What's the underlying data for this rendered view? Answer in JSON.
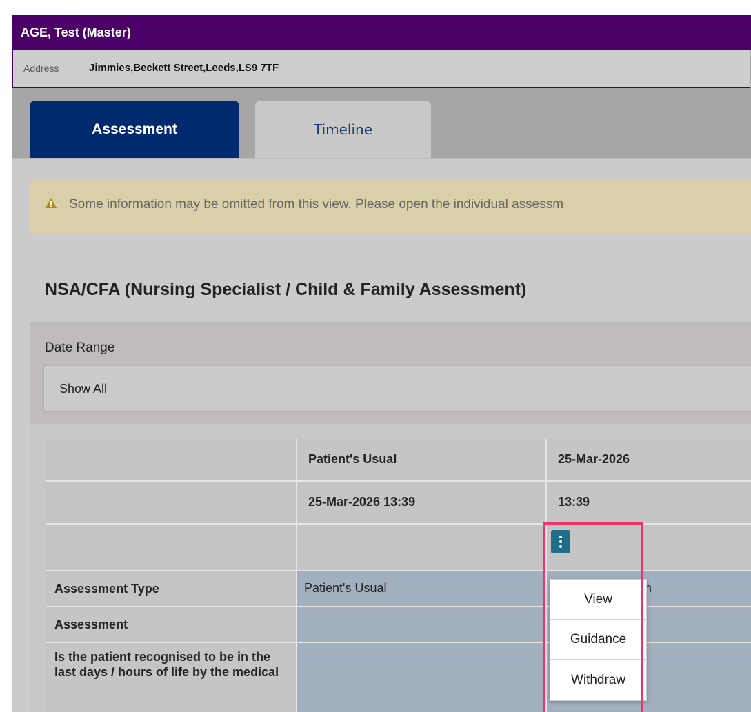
{
  "patient": {
    "name": "AGE, Test (Master)",
    "address_label": "Address",
    "address_value": "Jimmies,Beckett Street,Leeds,LS9 7TF"
  },
  "tabs": [
    {
      "label": "Assessment",
      "active": true
    },
    {
      "label": "Timeline",
      "active": false
    }
  ],
  "warning": {
    "icon": "warning-triangle-icon",
    "text": "Some information may be omitted from this view. Please open the individual assessm"
  },
  "card": {
    "title": "NSA/CFA (Nursing Specialist / Child & Family Assessment)",
    "date_range_label": "Date Range",
    "date_range_value": "Show All"
  },
  "grid": {
    "header_row1": [
      "",
      "Patient's Usual",
      "25-Mar-2026"
    ],
    "header_row2": [
      "",
      "25-Mar-2026 13:39",
      "13:39"
    ],
    "rows": [
      {
        "label": "Assessment Type",
        "col1": "Patient's Usual",
        "col2_partial": "on"
      },
      {
        "label": "Assessment",
        "col1": ""
      },
      {
        "label": "Is the patient recognised to be in the last days / hours of life by the medical",
        "col1": ""
      }
    ]
  },
  "actions_menu": {
    "kebab_icon": "more-vertical-icon",
    "items": [
      "View",
      "Guidance",
      "Withdraw"
    ]
  },
  "colors": {
    "header_purple": "#4a0066",
    "active_tab": "#002a6e",
    "warning_bg": "#d9cfa8",
    "kebab_bg": "#1f6f8b",
    "highlight": "#f0336b"
  }
}
